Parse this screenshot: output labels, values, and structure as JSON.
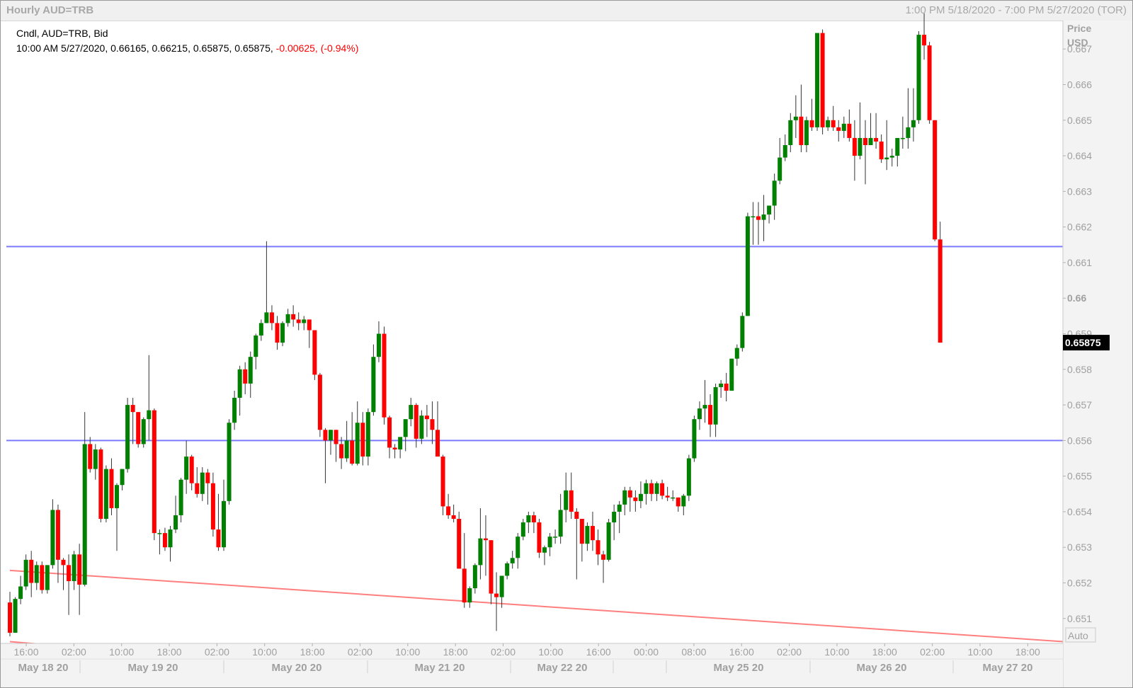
{
  "header": {
    "title": "Hourly AUD=TRB",
    "range": "1:00 PM 5/18/2020 - 7:00 PM 5/27/2020 (TOR)"
  },
  "legend": {
    "line1": "Cndl, AUD=TRB, Bid",
    "ohlc": "10:00 AM 5/27/2020, 0.66165, 0.66215, 0.65875, 0.65875,",
    "change": "-0.00625, (-0.94%)"
  },
  "axis": {
    "title": "Price",
    "unit": "USD",
    "auto_label": "Auto",
    "last_price": "0.65875"
  },
  "colors": {
    "up": "#008000",
    "down": "#ff0000",
    "hline": "#7b7bff",
    "trendline": "#ff7f7f",
    "grid_text": "#a0a0a0",
    "price_box": "#000000"
  },
  "chart_data": {
    "type": "candlestick",
    "title": "Hourly AUD=TRB",
    "ylabel": "Price USD",
    "ylim": [
      0.6503,
      0.6678
    ],
    "yticks": [
      "0.651",
      "0.652",
      "0.653",
      "0.654",
      "0.655",
      "0.656",
      "0.657",
      "0.658",
      "0.659",
      "0.66",
      "0.661",
      "0.662",
      "0.663",
      "0.664",
      "0.665",
      "0.666",
      "0.667"
    ],
    "xticks": [
      "16:00",
      "02:00",
      "10:00",
      "18:00",
      "02:00",
      "10:00",
      "18:00",
      "02:00",
      "10:00",
      "18:00",
      "02:00",
      "10:00",
      "16:00",
      "00:00",
      "08:00",
      "16:00",
      "02:00",
      "10:00",
      "18:00",
      "02:00",
      "10:00",
      "18:00"
    ],
    "dates": [
      "May 18 20",
      "May 19 20",
      "May 20 20",
      "May 21 20",
      "May 22 20",
      "May 25 20",
      "May 26 20",
      "May 27 20"
    ],
    "horizontal_lines": [
      0.66145,
      0.656
    ],
    "trendlines": [
      {
        "from": [
          0,
          0.65235
        ],
        "to": [
          197,
          0.65035
        ]
      },
      {
        "from": [
          0,
          0.65035
        ],
        "to": [
          65,
          0.64955
        ]
      }
    ],
    "candles": [
      [
        0.65145,
        0.65175,
        0.6505,
        0.6506
      ],
      [
        0.6506,
        0.6516,
        0.6506,
        0.65155
      ],
      [
        0.65155,
        0.6522,
        0.6514,
        0.6519
      ],
      [
        0.6519,
        0.6528,
        0.6518,
        0.65265
      ],
      [
        0.65265,
        0.6529,
        0.6516,
        0.652
      ],
      [
        0.652,
        0.6526,
        0.6518,
        0.6525
      ],
      [
        0.6525,
        0.6526,
        0.6517,
        0.6518
      ],
      [
        0.6518,
        0.6525,
        0.6517,
        0.6525
      ],
      [
        0.6525,
        0.65435,
        0.6524,
        0.65405
      ],
      [
        0.65405,
        0.6542,
        0.652,
        0.65265
      ],
      [
        0.65265,
        0.6527,
        0.6518,
        0.6525
      ],
      [
        0.6525,
        0.6528,
        0.6511,
        0.65205
      ],
      [
        0.65205,
        0.6529,
        0.6518,
        0.6528
      ],
      [
        0.6528,
        0.6531,
        0.6511,
        0.65195
      ],
      [
        0.65195,
        0.6568,
        0.6519,
        0.6559
      ],
      [
        0.6559,
        0.6561,
        0.6551,
        0.6552
      ],
      [
        0.6552,
        0.6559,
        0.6549,
        0.65575
      ],
      [
        0.65575,
        0.6558,
        0.6537,
        0.6538
      ],
      [
        0.6538,
        0.6553,
        0.6537,
        0.6552
      ],
      [
        0.6552,
        0.6555,
        0.6539,
        0.6541
      ],
      [
        0.6541,
        0.6548,
        0.6529,
        0.65475
      ],
      [
        0.65475,
        0.6552,
        0.6546,
        0.6552
      ],
      [
        0.6552,
        0.6572,
        0.6551,
        0.657
      ],
      [
        0.657,
        0.6572,
        0.6559,
        0.6568
      ],
      [
        0.6568,
        0.6568,
        0.6558,
        0.6559
      ],
      [
        0.6559,
        0.65665,
        0.6558,
        0.6566
      ],
      [
        0.6566,
        0.6584,
        0.656,
        0.65685
      ],
      [
        0.65685,
        0.6569,
        0.6532,
        0.6534
      ],
      [
        0.6534,
        0.6535,
        0.6528,
        0.6534
      ],
      [
        0.6534,
        0.65355,
        0.6529,
        0.653
      ],
      [
        0.653,
        0.6536,
        0.6526,
        0.6535
      ],
      [
        0.6535,
        0.65445,
        0.6534,
        0.6539
      ],
      [
        0.6539,
        0.65495,
        0.6537,
        0.6549
      ],
      [
        0.6549,
        0.656,
        0.6545,
        0.65555
      ],
      [
        0.65555,
        0.6556,
        0.6546,
        0.6548
      ],
      [
        0.6548,
        0.65525,
        0.6544,
        0.6545
      ],
      [
        0.6545,
        0.65525,
        0.6543,
        0.6551
      ],
      [
        0.6551,
        0.6552,
        0.6542,
        0.6548
      ],
      [
        0.6548,
        0.6551,
        0.6533,
        0.6535
      ],
      [
        0.6535,
        0.6545,
        0.6529,
        0.653
      ],
      [
        0.653,
        0.6549,
        0.6529,
        0.6543
      ],
      [
        0.6543,
        0.6566,
        0.6542,
        0.6565
      ],
      [
        0.6565,
        0.6574,
        0.6563,
        0.6572
      ],
      [
        0.6572,
        0.6581,
        0.6567,
        0.658
      ],
      [
        0.658,
        0.6582,
        0.6573,
        0.6576
      ],
      [
        0.6576,
        0.6585,
        0.6572,
        0.65835
      ],
      [
        0.65835,
        0.659,
        0.658,
        0.65895
      ],
      [
        0.65895,
        0.6594,
        0.6588,
        0.6593
      ],
      [
        0.6593,
        0.6616,
        0.6593,
        0.6596
      ],
      [
        0.6596,
        0.6598,
        0.6591,
        0.6593
      ],
      [
        0.6593,
        0.6595,
        0.65855,
        0.65875
      ],
      [
        0.65875,
        0.65935,
        0.65865,
        0.6593
      ],
      [
        0.6593,
        0.6597,
        0.6592,
        0.65955
      ],
      [
        0.65955,
        0.6598,
        0.6592,
        0.6594
      ],
      [
        0.6594,
        0.6596,
        0.6591,
        0.6593
      ],
      [
        0.6593,
        0.6595,
        0.6591,
        0.6594
      ],
      [
        0.6594,
        0.6594,
        0.6586,
        0.6591
      ],
      [
        0.6591,
        0.6591,
        0.6577,
        0.65785
      ],
      [
        0.65785,
        0.6579,
        0.6561,
        0.6563
      ],
      [
        0.6563,
        0.65635,
        0.6548,
        0.656
      ],
      [
        0.656,
        0.6563,
        0.6556,
        0.6563
      ],
      [
        0.6563,
        0.6563,
        0.6554,
        0.6559
      ],
      [
        0.6559,
        0.6561,
        0.6552,
        0.6555
      ],
      [
        0.6555,
        0.65655,
        0.6554,
        0.656
      ],
      [
        0.656,
        0.6568,
        0.6553,
        0.65535
      ],
      [
        0.65535,
        0.6571,
        0.6553,
        0.6565
      ],
      [
        0.6565,
        0.6568,
        0.6553,
        0.65555
      ],
      [
        0.65555,
        0.6569,
        0.6553,
        0.6568
      ],
      [
        0.6568,
        0.6587,
        0.6567,
        0.65835
      ],
      [
        0.65835,
        0.65935,
        0.6582,
        0.659
      ],
      [
        0.659,
        0.6592,
        0.65645,
        0.65665
      ],
      [
        0.65665,
        0.6567,
        0.6555,
        0.6558
      ],
      [
        0.6558,
        0.6559,
        0.6555,
        0.65575
      ],
      [
        0.65575,
        0.6559,
        0.6555,
        0.6561
      ],
      [
        0.6561,
        0.6566,
        0.6557,
        0.6566
      ],
      [
        0.6566,
        0.6572,
        0.6564,
        0.657
      ],
      [
        0.657,
        0.65705,
        0.6558,
        0.65605
      ],
      [
        0.65605,
        0.65685,
        0.6559,
        0.6567
      ],
      [
        0.6567,
        0.657,
        0.6561,
        0.6566
      ],
      [
        0.6566,
        0.6571,
        0.6559,
        0.6563
      ],
      [
        0.6563,
        0.6571,
        0.6556,
        0.65555
      ],
      [
        0.65555,
        0.6556,
        0.6539,
        0.65415
      ],
      [
        0.65415,
        0.6545,
        0.6538,
        0.6539
      ],
      [
        0.6539,
        0.6542,
        0.6537,
        0.6538
      ],
      [
        0.6538,
        0.654,
        0.6524,
        0.6524
      ],
      [
        0.6524,
        0.6534,
        0.6513,
        0.65145
      ],
      [
        0.65145,
        0.6519,
        0.6513,
        0.65185
      ],
      [
        0.65185,
        0.65255,
        0.6517,
        0.6525
      ],
      [
        0.6525,
        0.6541,
        0.6521,
        0.65325
      ],
      [
        0.65325,
        0.6539,
        0.6522,
        0.6532
      ],
      [
        0.6532,
        0.6532,
        0.6514,
        0.6517
      ],
      [
        0.6517,
        0.6523,
        0.65065,
        0.6516
      ],
      [
        0.6516,
        0.65205,
        0.6513,
        0.6522
      ],
      [
        0.6522,
        0.6526,
        0.6521,
        0.65255
      ],
      [
        0.65255,
        0.6529,
        0.6524,
        0.6527
      ],
      [
        0.6527,
        0.6534,
        0.6524,
        0.6533
      ],
      [
        0.6533,
        0.6538,
        0.6532,
        0.6537
      ],
      [
        0.6537,
        0.654,
        0.6534,
        0.6539
      ],
      [
        0.6539,
        0.654,
        0.6534,
        0.6537
      ],
      [
        0.6537,
        0.6538,
        0.6527,
        0.65285
      ],
      [
        0.65285,
        0.65305,
        0.6525,
        0.653
      ],
      [
        0.653,
        0.6534,
        0.65275,
        0.6533
      ],
      [
        0.6533,
        0.6535,
        0.6531,
        0.6533
      ],
      [
        0.6533,
        0.6545,
        0.6531,
        0.65405
      ],
      [
        0.65405,
        0.6551,
        0.6537,
        0.6546
      ],
      [
        0.6546,
        0.6551,
        0.6538,
        0.654
      ],
      [
        0.654,
        0.6541,
        0.6521,
        0.6538
      ],
      [
        0.6538,
        0.6538,
        0.6526,
        0.6531
      ],
      [
        0.6531,
        0.6537,
        0.6529,
        0.6536
      ],
      [
        0.6536,
        0.654,
        0.6529,
        0.6532
      ],
      [
        0.6532,
        0.6535,
        0.6525,
        0.6528
      ],
      [
        0.6528,
        0.6529,
        0.652,
        0.65265
      ],
      [
        0.65265,
        0.6538,
        0.6526,
        0.6537
      ],
      [
        0.6537,
        0.6542,
        0.6532,
        0.654
      ],
      [
        0.654,
        0.6543,
        0.6534,
        0.6542
      ],
      [
        0.6542,
        0.6547,
        0.6539,
        0.6546
      ],
      [
        0.6546,
        0.6547,
        0.654,
        0.6544
      ],
      [
        0.6544,
        0.6546,
        0.654,
        0.6543
      ],
      [
        0.6543,
        0.65485,
        0.6541,
        0.6545
      ],
      [
        0.6545,
        0.6549,
        0.6542,
        0.6548
      ],
      [
        0.6548,
        0.6549,
        0.6543,
        0.6545
      ],
      [
        0.6545,
        0.65485,
        0.6543,
        0.6548
      ],
      [
        0.6548,
        0.6549,
        0.65435,
        0.65445
      ],
      [
        0.65445,
        0.6547,
        0.6543,
        0.6544
      ],
      [
        0.6544,
        0.6546,
        0.6543,
        0.6544
      ],
      [
        0.6544,
        0.6544,
        0.654,
        0.65415
      ],
      [
        0.65415,
        0.6545,
        0.6539,
        0.65445
      ],
      [
        0.65445,
        0.6556,
        0.6543,
        0.6555
      ],
      [
        0.6555,
        0.6567,
        0.6554,
        0.6566
      ],
      [
        0.6566,
        0.6571,
        0.6563,
        0.6569
      ],
      [
        0.6569,
        0.6577,
        0.6565,
        0.657
      ],
      [
        0.657,
        0.6573,
        0.6561,
        0.65645
      ],
      [
        0.65645,
        0.6576,
        0.6561,
        0.6575
      ],
      [
        0.6575,
        0.6577,
        0.6572,
        0.6576
      ],
      [
        0.6576,
        0.6579,
        0.6571,
        0.6574
      ],
      [
        0.6574,
        0.6583,
        0.6574,
        0.6583
      ],
      [
        0.6583,
        0.6587,
        0.6581,
        0.6586
      ],
      [
        0.6586,
        0.6596,
        0.6585,
        0.6595
      ],
      [
        0.6595,
        0.6624,
        0.6595,
        0.6623
      ],
      [
        0.6623,
        0.6627,
        0.6615,
        0.6623
      ],
      [
        0.6623,
        0.6627,
        0.6615,
        0.6622
      ],
      [
        0.6622,
        0.6629,
        0.6616,
        0.66235
      ],
      [
        0.66235,
        0.6626,
        0.6621,
        0.6626
      ],
      [
        0.6626,
        0.6635,
        0.6622,
        0.6633
      ],
      [
        0.6633,
        0.6645,
        0.6632,
        0.66395
      ],
      [
        0.66395,
        0.6646,
        0.66385,
        0.6643
      ],
      [
        0.6643,
        0.6652,
        0.6641,
        0.665
      ],
      [
        0.665,
        0.6657,
        0.6645,
        0.6651
      ],
      [
        0.6651,
        0.666,
        0.6641,
        0.6643
      ],
      [
        0.6643,
        0.6651,
        0.6641,
        0.665
      ],
      [
        0.665,
        0.6656,
        0.6647,
        0.6648
      ],
      [
        0.6648,
        0.6669,
        0.6647,
        0.66745
      ],
      [
        0.66745,
        0.66755,
        0.6646,
        0.6648
      ],
      [
        0.6648,
        0.6651,
        0.6647,
        0.665
      ],
      [
        0.665,
        0.6654,
        0.6647,
        0.6648
      ],
      [
        0.6648,
        0.665,
        0.6644,
        0.6647
      ],
      [
        0.6647,
        0.6651,
        0.6645,
        0.6649
      ],
      [
        0.6649,
        0.6653,
        0.6644,
        0.6645
      ],
      [
        0.6645,
        0.665,
        0.6633,
        0.664
      ],
      [
        0.664,
        0.6655,
        0.6639,
        0.6645
      ],
      [
        0.6645,
        0.665,
        0.6632,
        0.6643
      ],
      [
        0.6643,
        0.6652,
        0.6643,
        0.6645
      ],
      [
        0.6645,
        0.6652,
        0.6642,
        0.6644
      ],
      [
        0.6644,
        0.6646,
        0.6638,
        0.6639
      ],
      [
        0.6639,
        0.665,
        0.6636,
        0.66395
      ],
      [
        0.66395,
        0.6642,
        0.6637,
        0.664
      ],
      [
        0.664,
        0.6645,
        0.6637,
        0.6645
      ],
      [
        0.6645,
        0.6651,
        0.6642,
        0.6645
      ],
      [
        0.6645,
        0.6659,
        0.6642,
        0.6648
      ],
      [
        0.6648,
        0.6659,
        0.6644,
        0.665
      ],
      [
        0.665,
        0.6675,
        0.6649,
        0.6674
      ],
      [
        0.6674,
        0.668,
        0.6667,
        0.6671
      ],
      [
        0.6671,
        0.6672,
        0.6649,
        0.665
      ],
      [
        0.665,
        0.665,
        0.6616,
        0.66165
      ],
      [
        0.66165,
        0.66215,
        0.65875,
        0.65875
      ]
    ]
  }
}
